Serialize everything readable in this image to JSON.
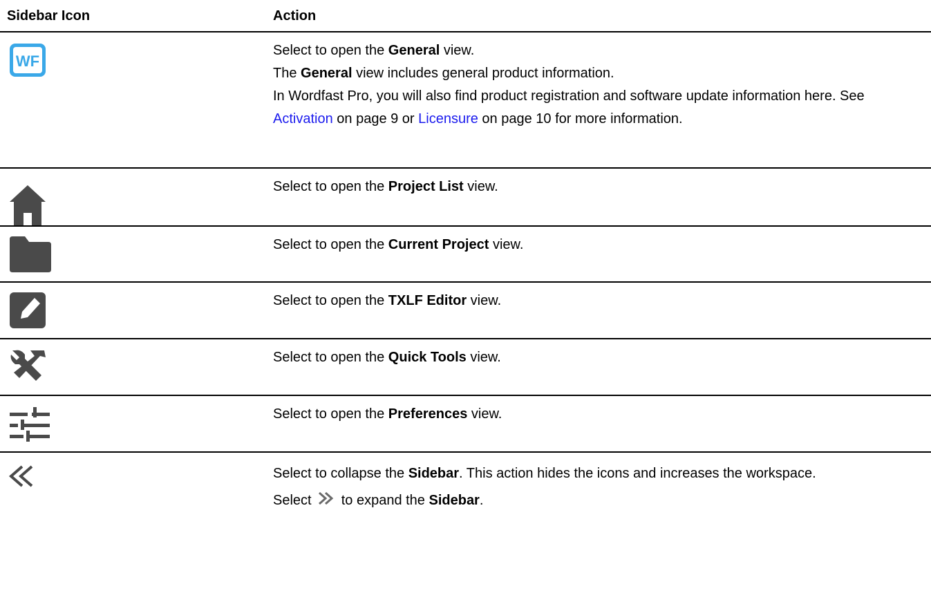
{
  "header": {
    "col1": "Sidebar Icon",
    "col2": "Action"
  },
  "colors": {
    "icon_gray": "#4a4a4a",
    "wf_blue": "#3aa8e8",
    "link_blue": "#1a1aee"
  },
  "rows": [
    {
      "icon": "wordfast-logo-icon",
      "logo_text": "WF",
      "lines": [
        {
          "pre": "Select to open the ",
          "bold": "General",
          "post": " view."
        },
        {
          "pre": "The ",
          "bold": "General",
          "post": " view includes general product information."
        }
      ],
      "para": {
        "text1": "In Wordfast Pro, you will also find product registration and software update information here. See ",
        "link1": "Activation",
        "text2": " on page 9 or ",
        "link2": "Licensure",
        "text3": " on page 10 for more information."
      }
    },
    {
      "icon": "home-icon",
      "pre": "Select to open the ",
      "bold": "Project List",
      "post": " view."
    },
    {
      "icon": "folder-icon",
      "pre": "Select to open the ",
      "bold": "Current Project",
      "post": " view."
    },
    {
      "icon": "edit-icon",
      "pre": "Select to open the ",
      "bold": "TXLF Editor",
      "post": " view."
    },
    {
      "icon": "tools-icon",
      "pre": "Select to open the ",
      "bold": "Quick Tools",
      "post": " view."
    },
    {
      "icon": "sliders-icon",
      "pre": "Select to open the ",
      "bold": "Preferences",
      "post": " view."
    },
    {
      "icon": "double-chevron-left-icon",
      "pre": "Select to collapse the ",
      "bold": "Sidebar",
      "post": ". This action hides the icons and increases the workspace.",
      "expand": {
        "pre": "Select ",
        "mid": " to expand the ",
        "bold": "Sidebar",
        "post": "."
      }
    }
  ]
}
